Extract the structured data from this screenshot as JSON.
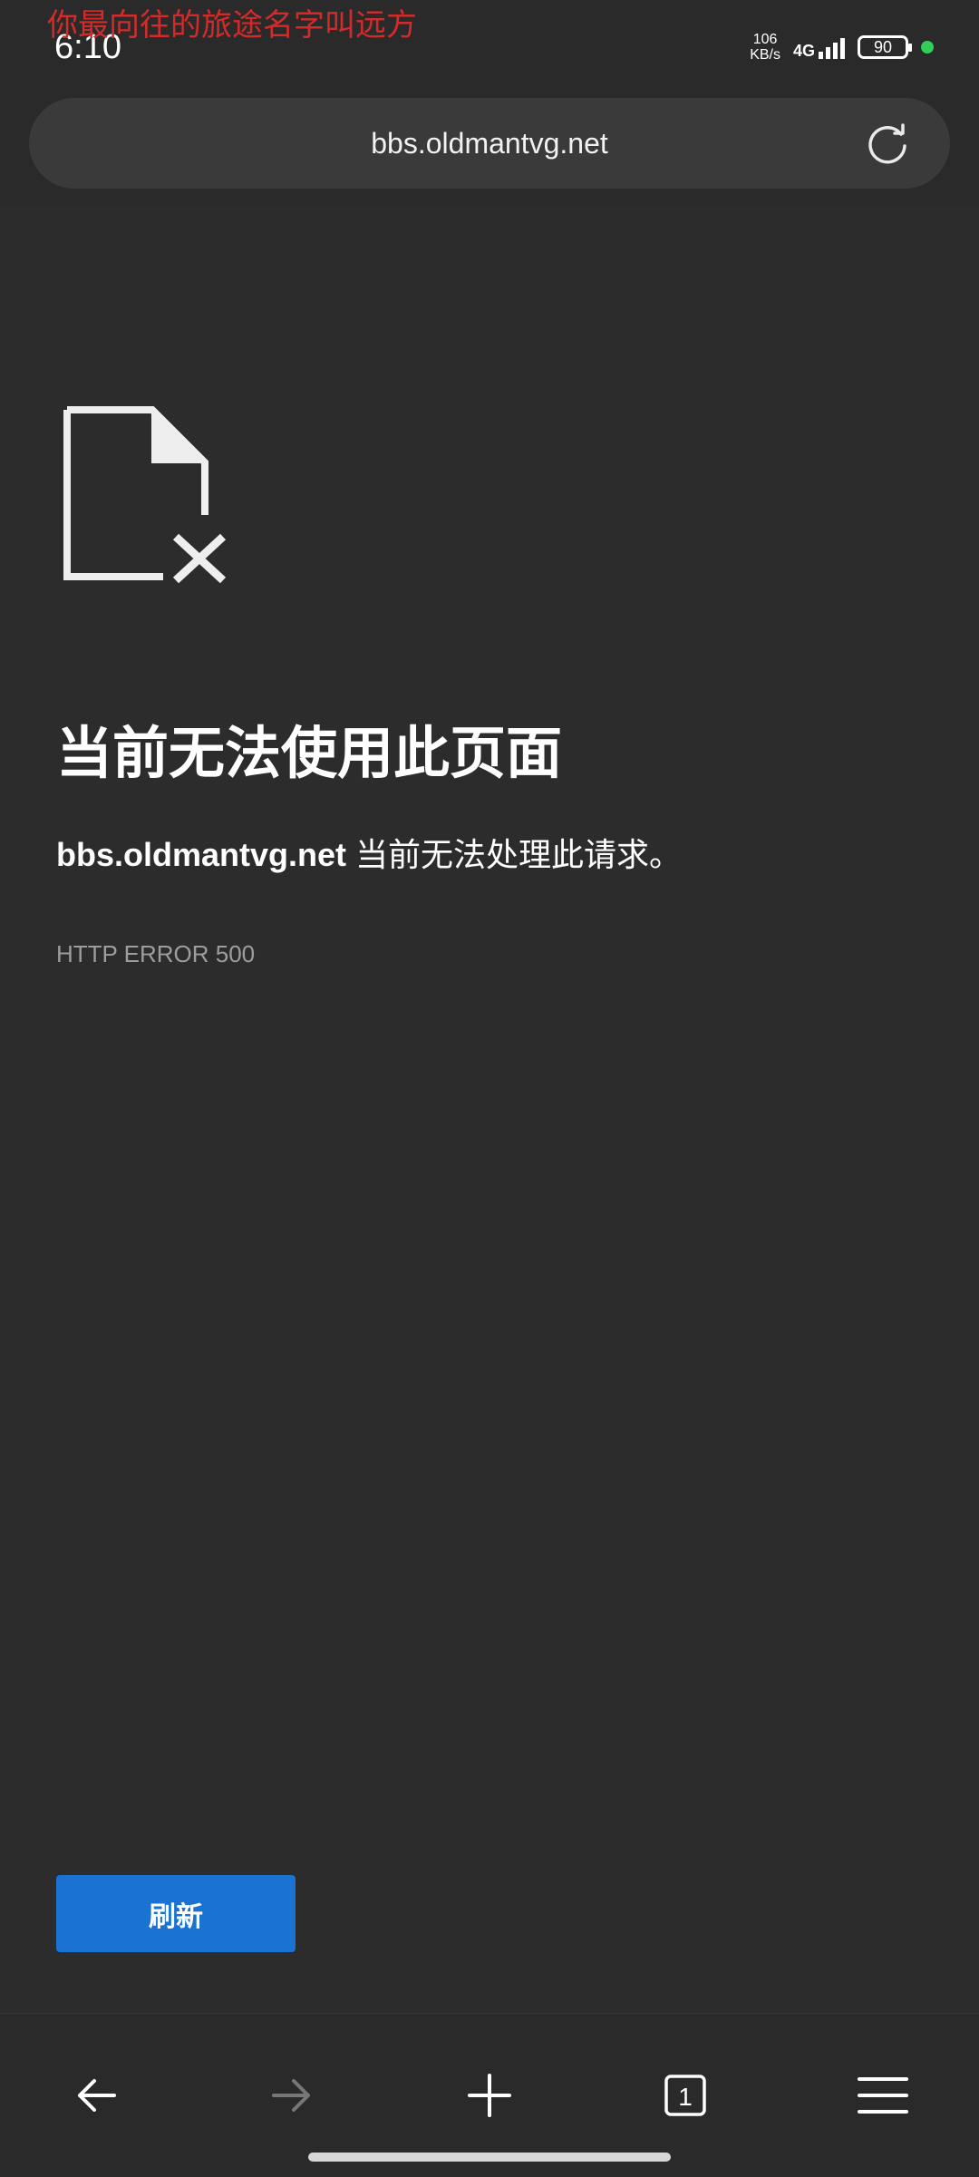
{
  "status_bar": {
    "overlay_text": "你最向往的旅途名字叫远方",
    "time": "6:10",
    "net_speed_value": "106",
    "net_speed_unit": "KB/s",
    "network": "4G",
    "battery": "90"
  },
  "address_bar": {
    "url": "bbs.oldmantvg.net"
  },
  "error_page": {
    "headline": "当前无法使用此页面",
    "host": "bbs.oldmantvg.net",
    "message": " 当前无法处理此请求。",
    "error_code": "HTTP ERROR 500",
    "refresh_label": "刷新"
  },
  "bottom_nav": {
    "tab_count": "1"
  },
  "colors": {
    "background": "#2c2c2c",
    "refresh_button": "#1a73d2",
    "overlay_text": "#d42a2a",
    "status_dot": "#2fcf58"
  },
  "icons": [
    "reload-icon",
    "error-file-icon",
    "back-icon",
    "forward-icon",
    "new-tab-icon",
    "tabs-icon",
    "menu-icon"
  ]
}
